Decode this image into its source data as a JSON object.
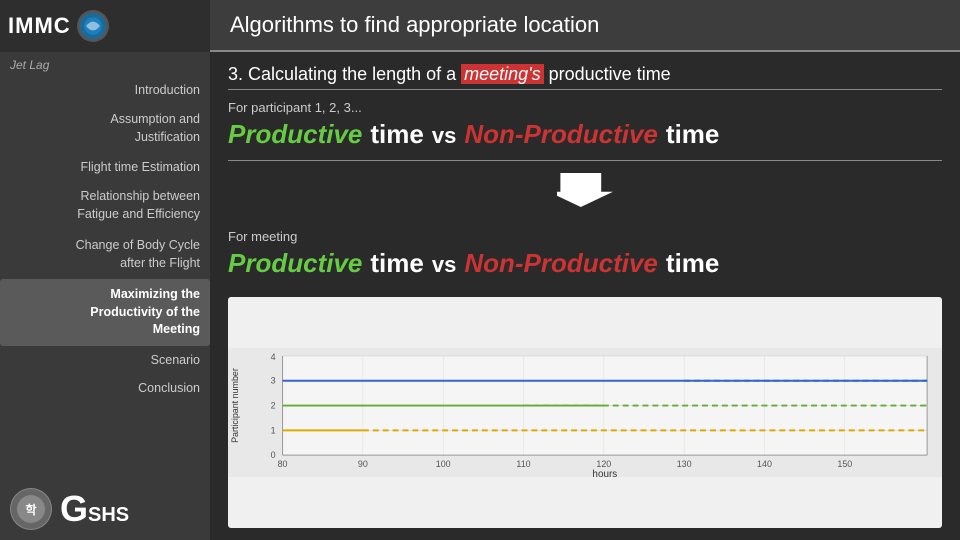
{
  "sidebar": {
    "logo_text": "IMMC",
    "jet_lag_label": "Jet Lag",
    "items": [
      {
        "label": "Introduction",
        "id": "introduction",
        "active": false
      },
      {
        "label": "Assumption and\nJustification",
        "id": "assumption",
        "active": false
      },
      {
        "label": "Flight time Estimation",
        "id": "flight-time",
        "active": false
      },
      {
        "label": "Relationship between\nFatigue and Efficiency",
        "id": "relationship",
        "active": false
      },
      {
        "label": "Change of Body Cycle\nafter the Flight",
        "id": "change-cycle",
        "active": false
      },
      {
        "label": "Maximizing the\nProductivity of the\nMeeting",
        "id": "maximizing",
        "active": true,
        "highlighted": true
      },
      {
        "label": "Scenario",
        "id": "scenario",
        "active": false
      },
      {
        "label": "Conclusion",
        "id": "conclusion",
        "active": false
      }
    ],
    "gshs_letter": "G",
    "gshs_sub": "SHS"
  },
  "main": {
    "header_title": "Algorithms to find appropriate location",
    "section_title_prefix": "3. Calculating the length of a ",
    "section_title_highlight": "meeting's",
    "section_title_suffix": " productive time",
    "block1": {
      "participant_label": "For participant 1, 2, 3...",
      "productive_label": "Productive",
      "time_label": "time",
      "vs_label": "vs",
      "nonproductive_label": "Non-Productive",
      "time_label2": "time"
    },
    "block2": {
      "meeting_label": "For meeting",
      "productive_label": "Productive",
      "time_label": "time",
      "vs_label": "vs",
      "nonproductive_label": "Non-Productive",
      "time_label2": "time"
    },
    "chart": {
      "x_label": "hours",
      "y_label": "Participant number",
      "x_values": [
        80,
        90,
        100,
        110,
        120,
        130,
        140,
        150
      ],
      "y_values": [
        0,
        1,
        2,
        3,
        4
      ]
    }
  },
  "icons": {
    "arrow_down": "arrow-down-icon",
    "logo_badge": "immc-logo-icon"
  }
}
